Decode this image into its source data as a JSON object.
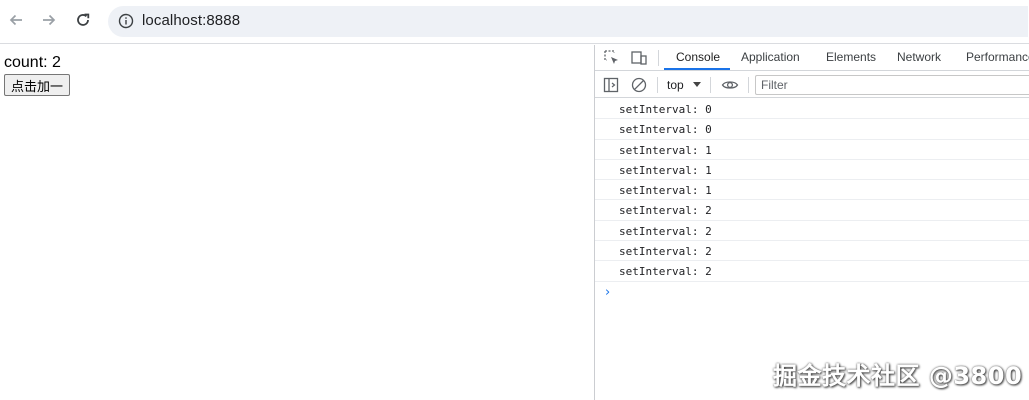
{
  "browser": {
    "url": "localhost:8888",
    "icons": {
      "back": "arrow-left-icon",
      "forward": "arrow-right-icon",
      "reload": "reload-icon",
      "info": "info-icon"
    }
  },
  "page": {
    "count_label": "count: 2",
    "add_button": "点击加一"
  },
  "devtools": {
    "tabs": [
      "Console",
      "Application",
      "Elements",
      "Network",
      "Performance"
    ],
    "active_tab": "Console",
    "context": "top",
    "filter_placeholder": "Filter",
    "logs": [
      "setInterval: 0",
      "setInterval: 0",
      "setInterval: 1",
      "setInterval: 1",
      "setInterval: 1",
      "setInterval: 2",
      "setInterval: 2",
      "setInterval: 2",
      "setInterval: 2"
    ],
    "prompt": "›",
    "accent": "#1a73e8"
  },
  "watermark": "掘金技术社区 @3800"
}
